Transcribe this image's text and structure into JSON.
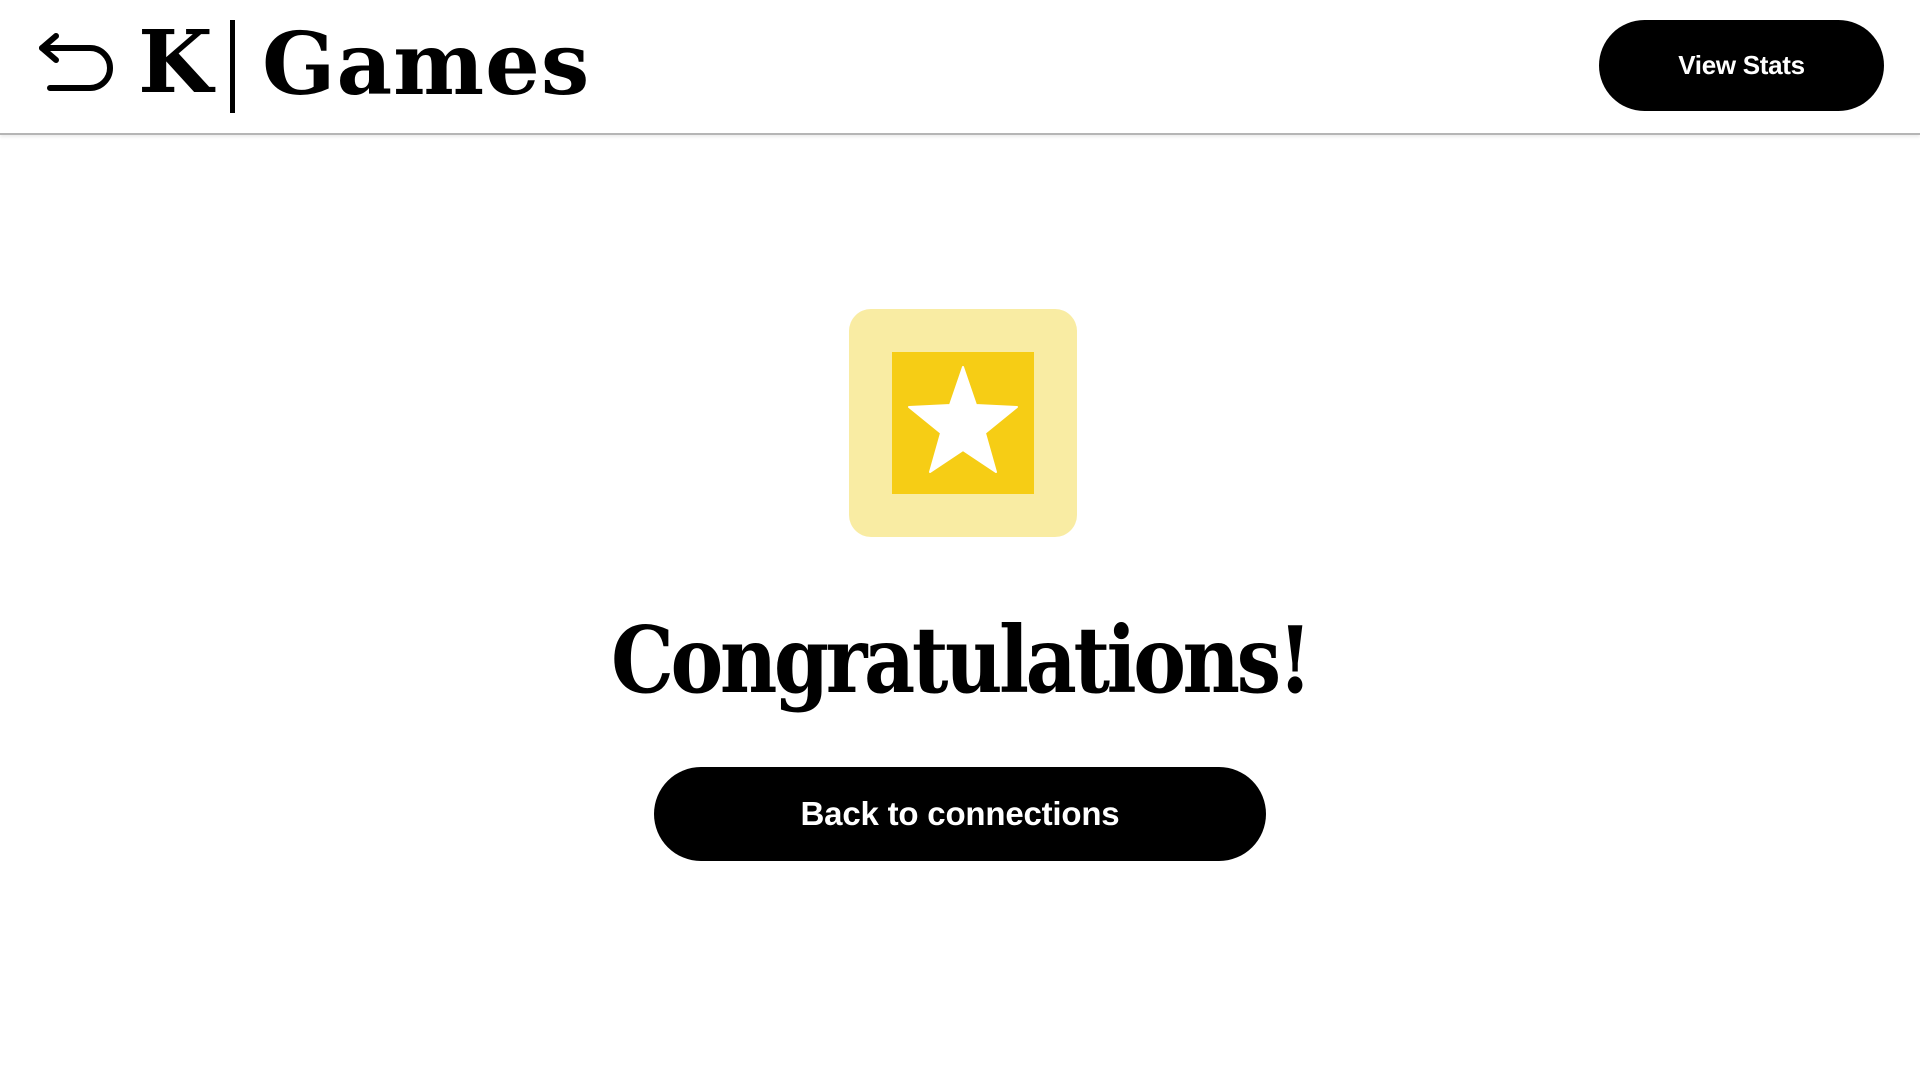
{
  "header": {
    "back_icon": "back-arrow-icon",
    "brand_initial": "K",
    "brand_title": "Games",
    "view_stats_label": "View Stats"
  },
  "main": {
    "badge_icon": "star-icon",
    "badge_colors": {
      "outer": "#f9eca3",
      "inner": "#f6cd15",
      "star": "#ffffff"
    },
    "heading": "Congratulations!",
    "back_button_label": "Back to connections"
  }
}
